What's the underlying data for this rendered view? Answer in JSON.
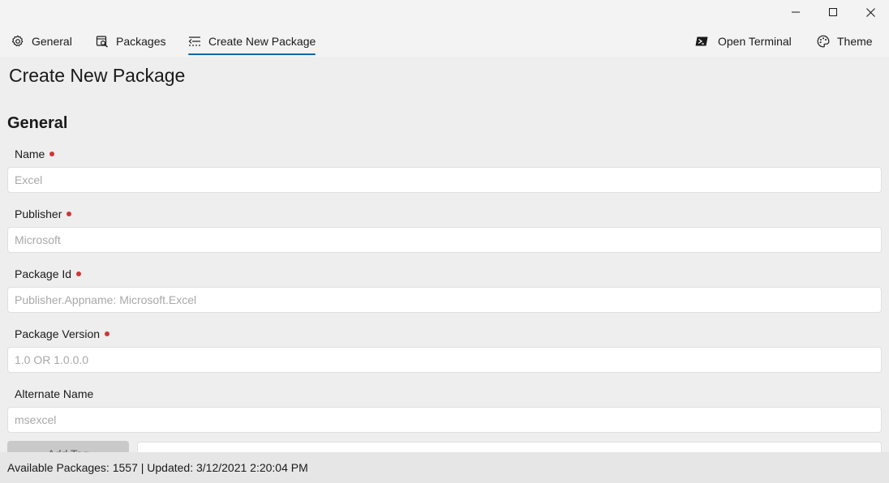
{
  "nav": {
    "left": [
      {
        "label": "General",
        "icon": "gear-icon"
      },
      {
        "label": "Packages",
        "icon": "package-search-icon"
      },
      {
        "label": "Create New Package",
        "icon": "create-package-icon"
      }
    ],
    "right": [
      {
        "label": "Open Terminal",
        "icon": "terminal-icon"
      },
      {
        "label": "Theme",
        "icon": "palette-icon"
      }
    ],
    "active": "Create New Package"
  },
  "page": {
    "title": "Create New Package",
    "section_title": "General"
  },
  "fields": [
    {
      "label": "Name",
      "required": true,
      "placeholder": "Excel",
      "value": ""
    },
    {
      "label": "Publisher",
      "required": true,
      "placeholder": "Microsoft",
      "value": ""
    },
    {
      "label": "Package Id",
      "required": true,
      "placeholder": "Publisher.Appname: Microsoft.Excel",
      "value": ""
    },
    {
      "label": "Package Version",
      "required": true,
      "placeholder": "1.0 OR 1.0.0.0",
      "value": ""
    },
    {
      "label": "Alternate Name",
      "required": false,
      "placeholder": "msexcel",
      "value": ""
    }
  ],
  "tags": {
    "add_button_label": "Add Tag"
  },
  "colors": {
    "accent": "#1464a8",
    "required": "#d13438"
  },
  "status": {
    "text": "Available Packages: 1557 | Updated: 3/12/2021 2:20:04 PM"
  }
}
